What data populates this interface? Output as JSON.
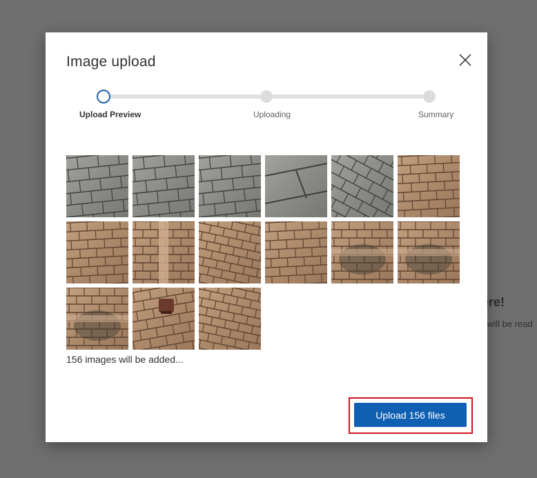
{
  "background": {
    "partial_heading": "ere!",
    "partial_text": "will be read"
  },
  "dialog": {
    "title": "Image upload",
    "close_icon": "close-icon",
    "steps": [
      {
        "label": "Upload Preview",
        "state": "active"
      },
      {
        "label": "Uploading",
        "state": "pending"
      },
      {
        "label": "Summary",
        "state": "pending"
      }
    ],
    "thumbnails": [
      {
        "type": "gray-shingle"
      },
      {
        "type": "gray-shingle"
      },
      {
        "type": "gray-shingle"
      },
      {
        "type": "gray-closeup"
      },
      {
        "type": "gray-diagonal"
      },
      {
        "type": "tan-shingle"
      },
      {
        "type": "tan-shingle"
      },
      {
        "type": "tan-ridge"
      },
      {
        "type": "tan-angled"
      },
      {
        "type": "tan-shingle"
      },
      {
        "type": "tan-stained"
      },
      {
        "type": "tan-stained"
      },
      {
        "type": "tan-stained"
      },
      {
        "type": "tan-vent"
      },
      {
        "type": "tan-angled"
      }
    ],
    "count_text": "156 images will be added...",
    "upload_button_label": "Upload 156 files"
  },
  "colors": {
    "accent": "#0f5fb2",
    "highlight": "#d0121b",
    "step_active": "#1f5fa8"
  }
}
